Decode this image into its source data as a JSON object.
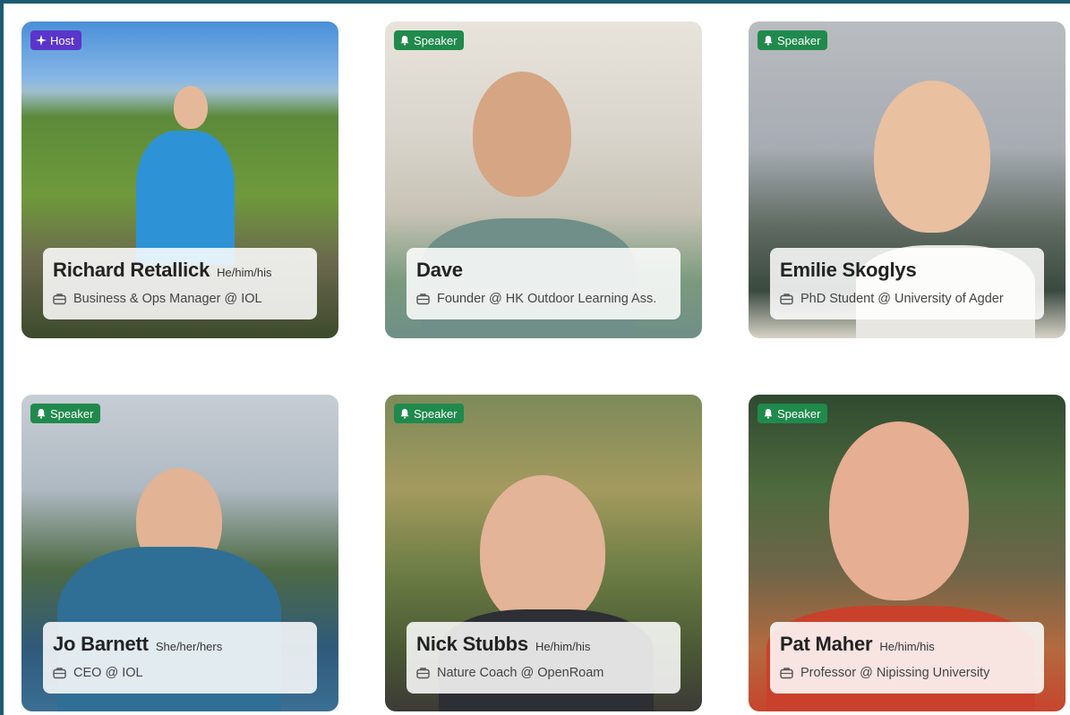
{
  "badges": {
    "host": "Host",
    "speaker": "Speaker"
  },
  "cards": [
    {
      "badge": "Host",
      "name": "Richard Retallick",
      "pronouns": "He/him/his",
      "role": "Business & Ops Manager @ IOL"
    },
    {
      "badge": "Speaker",
      "name": "Dave",
      "pronouns": "",
      "role": "Founder @ HK Outdoor Learning Ass."
    },
    {
      "badge": "Speaker",
      "name": "Emilie Skoglys",
      "pronouns": "",
      "role": "PhD Student @ University of Agder"
    },
    {
      "badge": "Speaker",
      "name": "Jo Barnett",
      "pronouns": "She/her/hers",
      "role": "CEO @ IOL"
    },
    {
      "badge": "Speaker",
      "name": "Nick Stubbs",
      "pronouns": "He/him/his",
      "role": "Nature Coach @ OpenRoam"
    },
    {
      "badge": "Speaker",
      "name": "Pat Maher",
      "pronouns": "He/him/his",
      "role": "Professor @ Nipissing University"
    }
  ],
  "colors": {
    "frame": "#1e5a74",
    "speaker_badge": "#1f8a4c",
    "host_badge": "#5b35c9"
  },
  "icons": {
    "badge_speaker": "bell-icon",
    "badge_host": "sparkle-icon",
    "role": "briefcase-icon"
  }
}
